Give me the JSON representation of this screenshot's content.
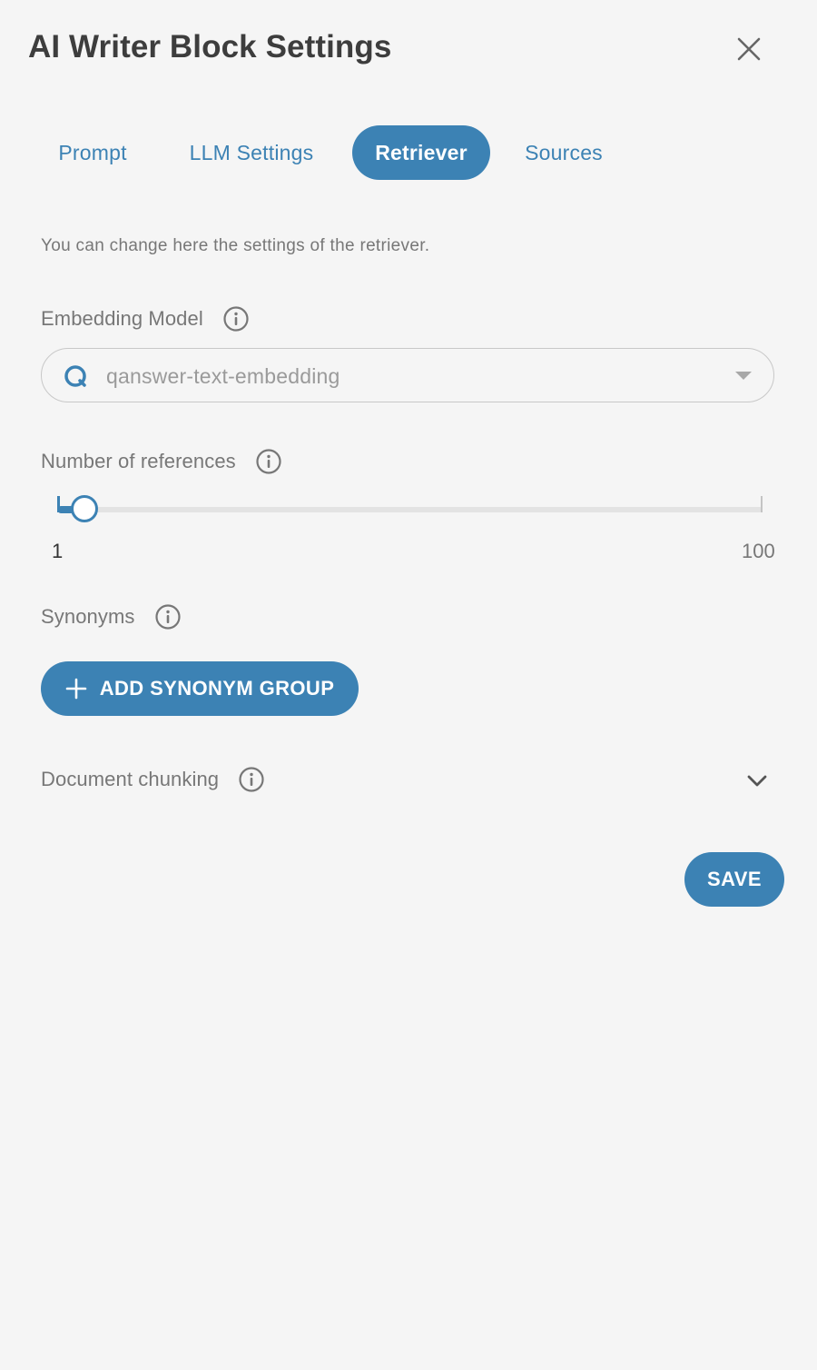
{
  "dialog": {
    "title": "AI Writer Block Settings"
  },
  "tabs": [
    {
      "label": "Prompt",
      "active": false
    },
    {
      "label": "LLM Settings",
      "active": false
    },
    {
      "label": "Retriever",
      "active": true
    },
    {
      "label": "Sources",
      "active": false
    }
  ],
  "retriever": {
    "description": "You can change here the settings of the retriever.",
    "embedding_model": {
      "label": "Embedding Model",
      "value": "qanswer-text-embedding"
    },
    "references": {
      "label": "Number of references",
      "min_label": "1",
      "max_label": "100",
      "min": 1,
      "max": 100,
      "value": 1
    },
    "synonyms": {
      "label": "Synonyms",
      "add_button_label": "ADD SYNONYM GROUP"
    },
    "chunking": {
      "label": "Document chunking",
      "expanded": false
    }
  },
  "footer": {
    "save_label": "SAVE"
  },
  "colors": {
    "accent": "#3c82b4",
    "background": "#f5f5f5",
    "label": "#777777",
    "title": "#3d3d3d"
  }
}
